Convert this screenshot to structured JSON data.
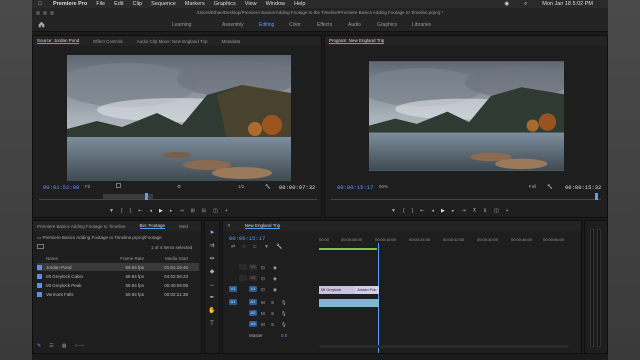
{
  "menubar": {
    "app": "Premiere Pro",
    "items": [
      "File",
      "Edit",
      "Clip",
      "Sequence",
      "Markers",
      "Graphics",
      "View",
      "Window",
      "Help"
    ],
    "clock": "Mon Jan 18  5:02 PM"
  },
  "titlebar": {
    "path": "/Users/Ethan/Desktop/Premiere Basics/Adding Footage to the Timeline/Premiere Basics Adding Footage to Timeline.prproj *"
  },
  "workspaces": {
    "tabs": [
      "Learning",
      "Assembly",
      "Editing",
      "Color",
      "Effects",
      "Audio",
      "Graphics",
      "Libraries"
    ],
    "active": "Editing"
  },
  "source": {
    "tabs": [
      "Source: Jordan Pond",
      "Effect Controls",
      "Audio Clip Mixer: New England Trip",
      "Metadata"
    ],
    "timecode_in": "00:01:52:09",
    "fit": "Fit",
    "resolution": "1/2",
    "timecode_out": "00:00:07:32"
  },
  "program": {
    "tab": "Program: New England Trip",
    "timecode_in": "00:00:15:17",
    "zoom": "50%",
    "quality": "Full",
    "timecode_out": "00:00:15:32"
  },
  "project": {
    "tabs": [
      "Premiere Basics Adding Footage to Timeline",
      "Bin: Footage",
      "Med"
    ],
    "path": "Premiere Basics Adding Footage to Timeline.prproj\\Footage",
    "count": "1 of 4 items selected",
    "columns": [
      "Name",
      "Frame Rate",
      "Media Start"
    ],
    "rows": [
      {
        "name": "Jordan Pond",
        "fps": "59.94 fps",
        "start": "01:51:16:46"
      },
      {
        "name": "Mt Greylock Cabin",
        "fps": "59.94 fps",
        "start": "04:02:56:23"
      },
      {
        "name": "Mt Greylock Peak",
        "fps": "59.94 fps",
        "start": "00:40:09:08"
      },
      {
        "name": "Vermont Falls",
        "fps": "59.94 fps",
        "start": "00:02:21:39"
      }
    ]
  },
  "timeline": {
    "tab": "New England Trip",
    "timecode": "00:00:15:17",
    "ruler": [
      "00:00",
      "00:00:08:00",
      "00:00:16:00",
      "00:00:24:00",
      "00:00:32:00",
      "00:00:40:00",
      "00:00:48:00",
      "00:00:56:00"
    ],
    "tracks_video": [
      "V3",
      "V2",
      "V1"
    ],
    "tracks_audio": [
      "A1",
      "A2",
      "A3"
    ],
    "master": "Master",
    "master_value": "0.0",
    "clips": {
      "video": [
        "Mt Greylock",
        "Jordan Pon"
      ]
    }
  },
  "colors": {
    "accent": "#5a9bff",
    "clip_video": "#c9c2e0",
    "clip_audio": "#7fb6d8"
  }
}
